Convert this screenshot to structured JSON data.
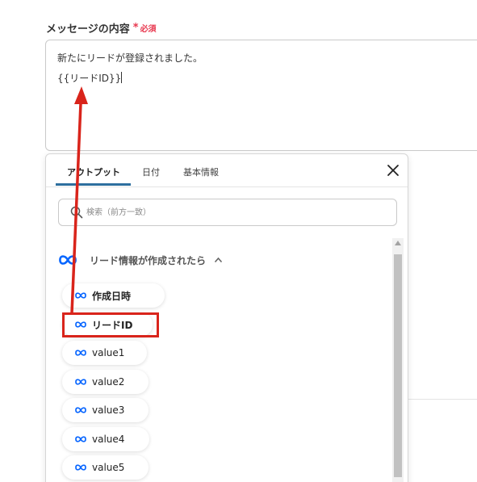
{
  "field": {
    "label": "メッセージの内容",
    "required_star": "*",
    "required_text": "必須",
    "line1": "新たにリードが登録されました。",
    "line2": "{{リードID}}"
  },
  "popup": {
    "tabs": [
      {
        "label": "アウトプット",
        "active": true
      },
      {
        "label": "日付",
        "active": false
      },
      {
        "label": "基本情報",
        "active": false
      }
    ],
    "search_placeholder": "検索（前方一致）",
    "group": {
      "icon": "meta-logo-icon",
      "label": "リード情報が作成されたら"
    },
    "items": [
      {
        "label": "作成日時",
        "icon": "meta-logo-icon"
      },
      {
        "label": "リードID",
        "icon": "meta-logo-icon",
        "highlighted": true
      },
      {
        "label": "value1",
        "icon": "meta-logo-icon"
      },
      {
        "label": "value2",
        "icon": "meta-logo-icon"
      },
      {
        "label": "value3",
        "icon": "meta-logo-icon"
      },
      {
        "label": "value4",
        "icon": "meta-logo-icon"
      },
      {
        "label": "value5",
        "icon": "meta-logo-icon"
      }
    ]
  },
  "colors": {
    "meta_blue": "#0866ff",
    "required": "#e8384f",
    "annotation_red": "#d9241b",
    "tab_underline": "#2e6f9e"
  }
}
